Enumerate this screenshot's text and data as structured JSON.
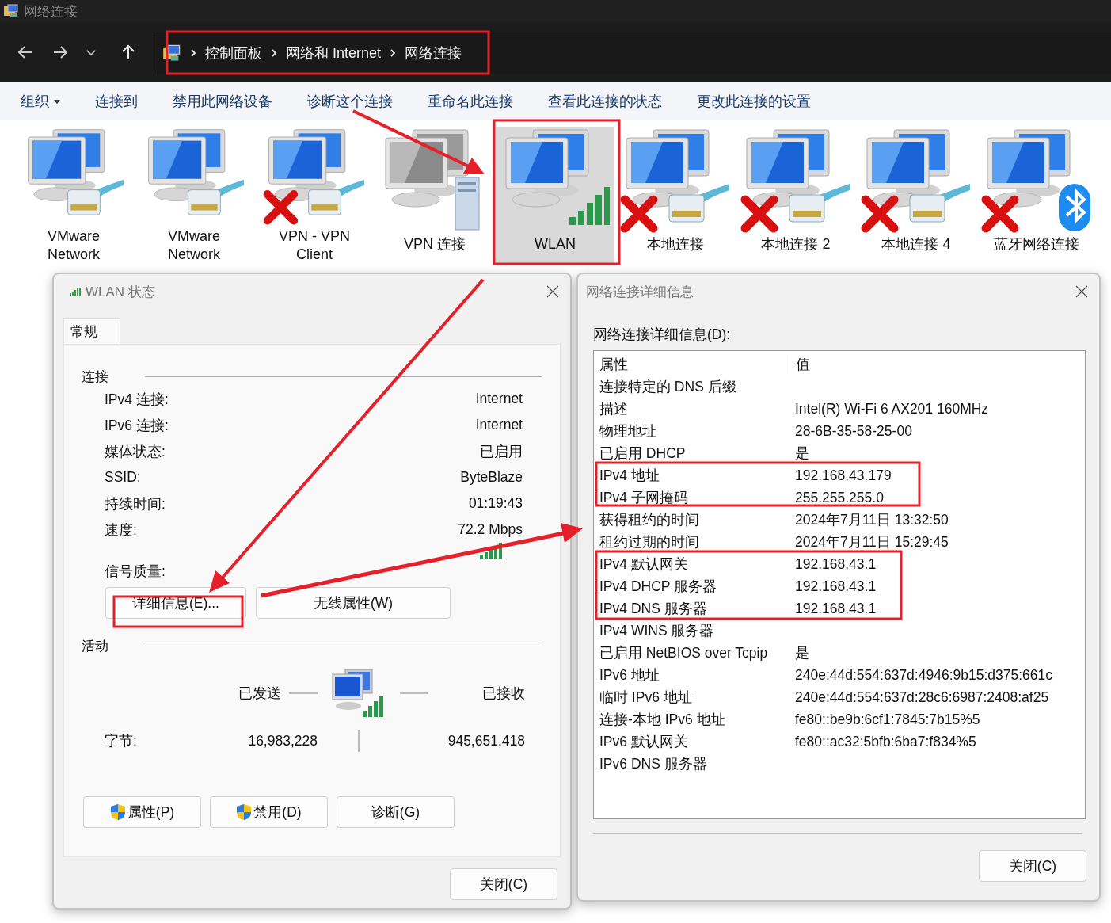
{
  "window": {
    "title": "网络连接"
  },
  "breadcrumb": [
    "控制面板",
    "网络和 Internet",
    "网络连接"
  ],
  "commands": [
    {
      "label": "组织",
      "dropdown": true
    },
    {
      "label": "连接到",
      "dropdown": false
    },
    {
      "label": "禁用此网络设备",
      "dropdown": false
    },
    {
      "label": "诊断这个连接",
      "dropdown": false
    },
    {
      "label": "重命名此连接",
      "dropdown": false
    },
    {
      "label": "查看此连接的状态",
      "dropdown": false
    },
    {
      "label": "更改此连接的设置",
      "dropdown": false
    }
  ],
  "connections": [
    {
      "name": "VMware Network",
      "kind": "ethernet",
      "disabled": false,
      "selected": false
    },
    {
      "name": "VMware Network",
      "kind": "ethernet",
      "disabled": false,
      "selected": false
    },
    {
      "name": "VPN - VPN Client",
      "kind": "ethernet",
      "disabled": true,
      "selected": false
    },
    {
      "name": "VPN 连接",
      "kind": "vpn",
      "disabled": false,
      "selected": false
    },
    {
      "name": "WLAN",
      "kind": "wifi",
      "disabled": false,
      "selected": true
    },
    {
      "name": "本地连接",
      "kind": "ethernet",
      "disabled": true,
      "selected": false
    },
    {
      "name": "本地连接 2",
      "kind": "ethernet",
      "disabled": true,
      "selected": false
    },
    {
      "name": "本地连接 4",
      "kind": "ethernet",
      "disabled": true,
      "selected": false
    },
    {
      "name": "蓝牙网络连接",
      "kind": "bluetooth",
      "disabled": true,
      "selected": false
    }
  ],
  "status_dialog": {
    "title": "WLAN 状态",
    "tabs": [
      {
        "label": "常规",
        "selected": true
      }
    ],
    "connection_heading": "连接",
    "rows": [
      {
        "label": "IPv4 连接:",
        "value": "Internet"
      },
      {
        "label": "IPv6 连接:",
        "value": "Internet"
      },
      {
        "label": "媒体状态:",
        "value": "已启用"
      },
      {
        "label": "SSID:",
        "value": "ByteBlaze"
      },
      {
        "label": "持续时间:",
        "value": "01:19:43"
      },
      {
        "label": "速度:",
        "value": "72.2 Mbps"
      }
    ],
    "signal_label": "信号质量:",
    "buttons": [
      "详细信息(E)...",
      "无线属性(W)"
    ],
    "activity_heading": "活动",
    "sent_label": "已发送",
    "received_label": "已接收",
    "bytes_label": "字节:",
    "bytes_sent": "16,983,228",
    "bytes_received": "945,651,418",
    "action_buttons": [
      {
        "label": "属性(P)",
        "shield": true
      },
      {
        "label": "禁用(D)",
        "shield": true
      },
      {
        "label": "诊断(G)",
        "shield": false
      }
    ],
    "close_button": "关闭(C)"
  },
  "details_dialog": {
    "title": "网络连接详细信息",
    "list_label": "网络连接详细信息(D):",
    "columns": [
      "属性",
      "值"
    ],
    "rows": [
      {
        "property": "连接特定的 DNS 后缀"
      },
      {
        "property": "描述",
        "value": "Intel(R) Wi-Fi 6 AX201 160MHz"
      },
      {
        "property": "物理地址",
        "value": "28-6B-35-58-25-00"
      },
      {
        "property": "已启用 DHCP",
        "value": "是"
      },
      {
        "property": "IPv4 地址",
        "value": "192.168.43.179"
      },
      {
        "property": "IPv4 子网掩码",
        "value": "255.255.255.0"
      },
      {
        "property": "获得租约的时间",
        "value": "2024年7月11日 13:32:50"
      },
      {
        "property": "租约过期的时间",
        "value": "2024年7月11日 15:29:45"
      },
      {
        "property": "IPv4 默认网关",
        "value": "192.168.43.1"
      },
      {
        "property": "IPv4 DHCP 服务器",
        "value": "192.168.43.1"
      },
      {
        "property": "IPv4 DNS 服务器",
        "value": "192.168.43.1"
      },
      {
        "property": "IPv4 WINS 服务器"
      },
      {
        "property": "已启用 NetBIOS over Tcpip",
        "value": "是"
      },
      {
        "property": "IPv6 地址",
        "value": "240e:44d:554:637d:4946:9b15:d375:661c"
      },
      {
        "property": "临时 IPv6 地址",
        "value": "240e:44d:554:637d:28c6:6987:2408:af25"
      },
      {
        "property": "连接-本地 IPv6 地址",
        "value": "fe80::be9b:6cf1:7845:7b15%5"
      },
      {
        "property": "IPv6 默认网关",
        "value": "fe80::ac32:5bfb:6ba7:f834%5"
      },
      {
        "property": "IPv6 DNS 服务器"
      }
    ],
    "close_button": "关闭(C)"
  }
}
